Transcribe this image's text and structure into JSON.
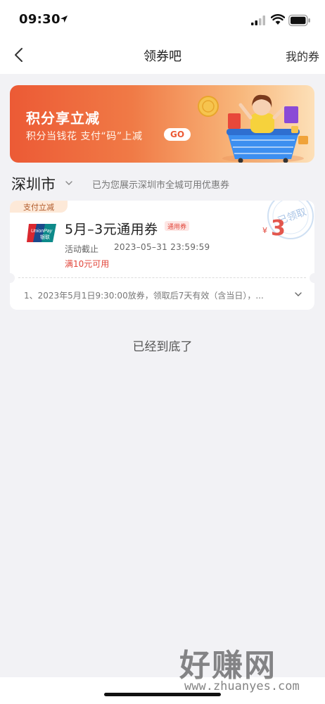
{
  "status_bar": {
    "time": "09:30"
  },
  "nav": {
    "title": "领券吧",
    "right_label": "我的券"
  },
  "banner": {
    "title": "积分享立减",
    "subtitle": "积分当钱花  支付“码”上减",
    "go_label": "GO"
  },
  "city": {
    "name": "深圳市",
    "hint": "已为您展示深圳市全城可用优惠券"
  },
  "coupon": {
    "tag": "支付立减",
    "logo_text": "UnionPay 银联",
    "title": "5月–3元通用券",
    "type_badge": "通用券",
    "deadline_label": "活动截止",
    "deadline": "2023–05–31 23:59:59",
    "condition": "满10元可用",
    "currency": "¥",
    "amount": "3",
    "stamp_text": "已领取",
    "rules": "1、2023年5月1日9:30:00放券，领取后7天有效（含当日），..."
  },
  "footer": {
    "end_text": "已经到底了"
  },
  "watermark": {
    "main": "好赚网",
    "url": "www.zhuanyes.com"
  },
  "colors": {
    "accent_red": "#e2463b",
    "banner_orange": "#ec5a35",
    "background": "#f2f2f5"
  }
}
